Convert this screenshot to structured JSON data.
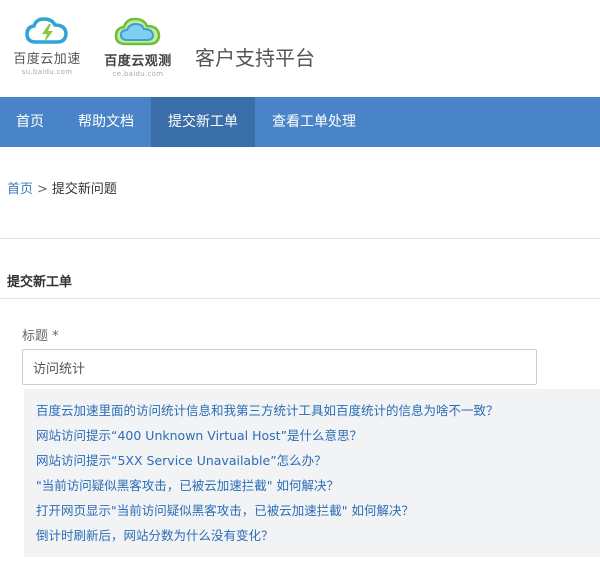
{
  "header": {
    "logo_jsl": {
      "name": "百度云加速",
      "url": "su.baidu.com",
      "icon": "cloud-lightning-icon"
    },
    "logo_gc": {
      "name": "百度云观测",
      "url": "ce.baidu.com",
      "icon": "cloud-icon"
    },
    "platform_title": "客户支持平台"
  },
  "nav": {
    "items": [
      {
        "label": "首页"
      },
      {
        "label": "帮助文档"
      },
      {
        "label": "提交新工单"
      },
      {
        "label": "查看工单处理"
      }
    ],
    "active_index": 2
  },
  "breadcrumb": {
    "home": "首页",
    "separator": ">",
    "current": "提交新问题"
  },
  "form": {
    "section_title": "提交新工单",
    "title_label": "标题 *",
    "title_value": "访问统计"
  },
  "suggestions": [
    "百度云加速里面的访问统计信息和我第三方统计工具如百度统计的信息为啥不一致？",
    "网站访问提示“400 Unknown Virtual Host”是什么意思？",
    "网站访问提示“5XX Service Unavailable”怎么办？",
    "\"当前访问疑似黑客攻击，已被云加速拦截\" 如何解决？",
    "打开网页显示\"当前访问疑似黑客攻击，已被云加速拦截\" 如何解决？",
    "倒计时刷新后，网站分数为什么没有变化？"
  ],
  "colors": {
    "nav_bg": "#4a84c8",
    "nav_active_bg": "#3a6ea8",
    "link": "#2c6db5",
    "suggestion_bg": "#f1f3f5"
  }
}
